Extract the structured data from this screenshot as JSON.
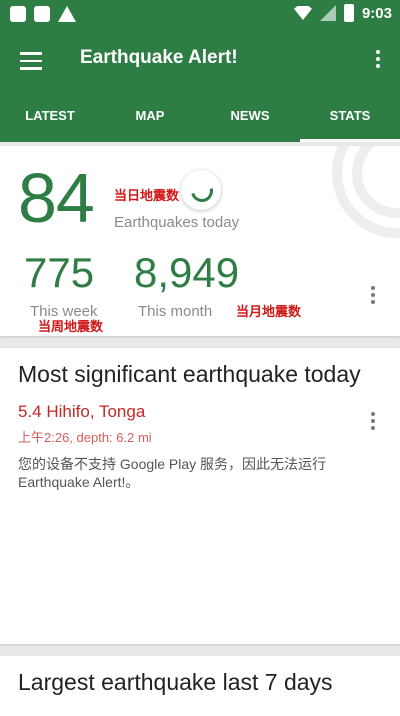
{
  "status_bar": {
    "time": "9:03"
  },
  "app_bar": {
    "title": "Earthquake Alert!"
  },
  "tabs": [
    {
      "label": "LATEST"
    },
    {
      "label": "MAP"
    },
    {
      "label": "NEWS"
    },
    {
      "label": "STATS"
    }
  ],
  "stats": {
    "today_count": "84",
    "today_label": "Earthquakes today",
    "week_count": "775",
    "week_label": "This week",
    "month_count": "8,949",
    "month_label": "This month",
    "annot_today": "当日地震数",
    "annot_week": "当周地震数",
    "annot_month": "当月地震数"
  },
  "significant": {
    "heading": "Most significant earthquake today",
    "quake_title": "5.4 Hihifo, Tonga",
    "quake_meta": "上午2:26, depth: 6.2 mi",
    "message": "您的设备不支持 Google Play 服务，因此无法运行 Earthquake Alert!。"
  },
  "largest": {
    "heading": "Largest earthquake last 7 days"
  },
  "colors": {
    "primary": "#2e7d44",
    "quake_red": "#c62828",
    "annotation_red": "#d01919"
  }
}
